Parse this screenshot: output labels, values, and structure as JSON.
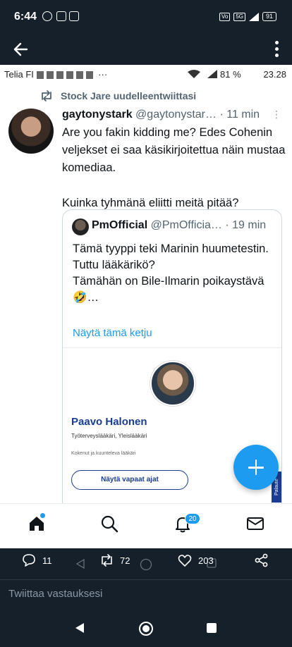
{
  "status_bar": {
    "time": "6:44",
    "battery": "91",
    "network": "5G"
  },
  "inner_status": {
    "carrier": "Telia FI",
    "ellipsis": "···",
    "signal_text": "81 %",
    "time": "23.28"
  },
  "retweet": {
    "text": "Stock Jare uudelleentwiittasi"
  },
  "tweet": {
    "name": "gaytonystark",
    "handle": "@gaytonystar…",
    "time": "· 11 min",
    "paragraph1": "Are you fakin kidding me? Edes Cohenin veljekset ei saa käsikirjoitettua näin mustaa komediaa.",
    "paragraph2": "Kuinka tyhmänä eliitti meitä pitää?"
  },
  "quote": {
    "name": "PmOfficial",
    "handle": "@PmOfficia…",
    "time": "· 19 min",
    "line1": "Tämä tyyppi teki Marinin huumetestin.",
    "line2": "Tuttu lääkärikö?",
    "line3": "Tämähän on Bile-Ilmarin poikaystävä",
    "line4": "🤣…",
    "thread_link": "Näytä tämä ketju",
    "card": {
      "name": "Paavo Halonen",
      "role": "Työterveyslääkäri, Yleislääkäri",
      "description": "Kokenut ja kuunteleva lääkäri",
      "button": "Näytä vapaat ajat",
      "feedback_tab": "Palaute",
      "accent": "#1a3d8f"
    }
  },
  "inner_nav": {
    "notifications_badge": "20"
  },
  "actions": {
    "replies": "11",
    "retweets": "72",
    "likes": "203"
  },
  "reply": {
    "placeholder": "Twiittaa vastauksesi"
  },
  "colors": {
    "accent": "#1d9bf0",
    "dark_bg": "#15202b"
  }
}
